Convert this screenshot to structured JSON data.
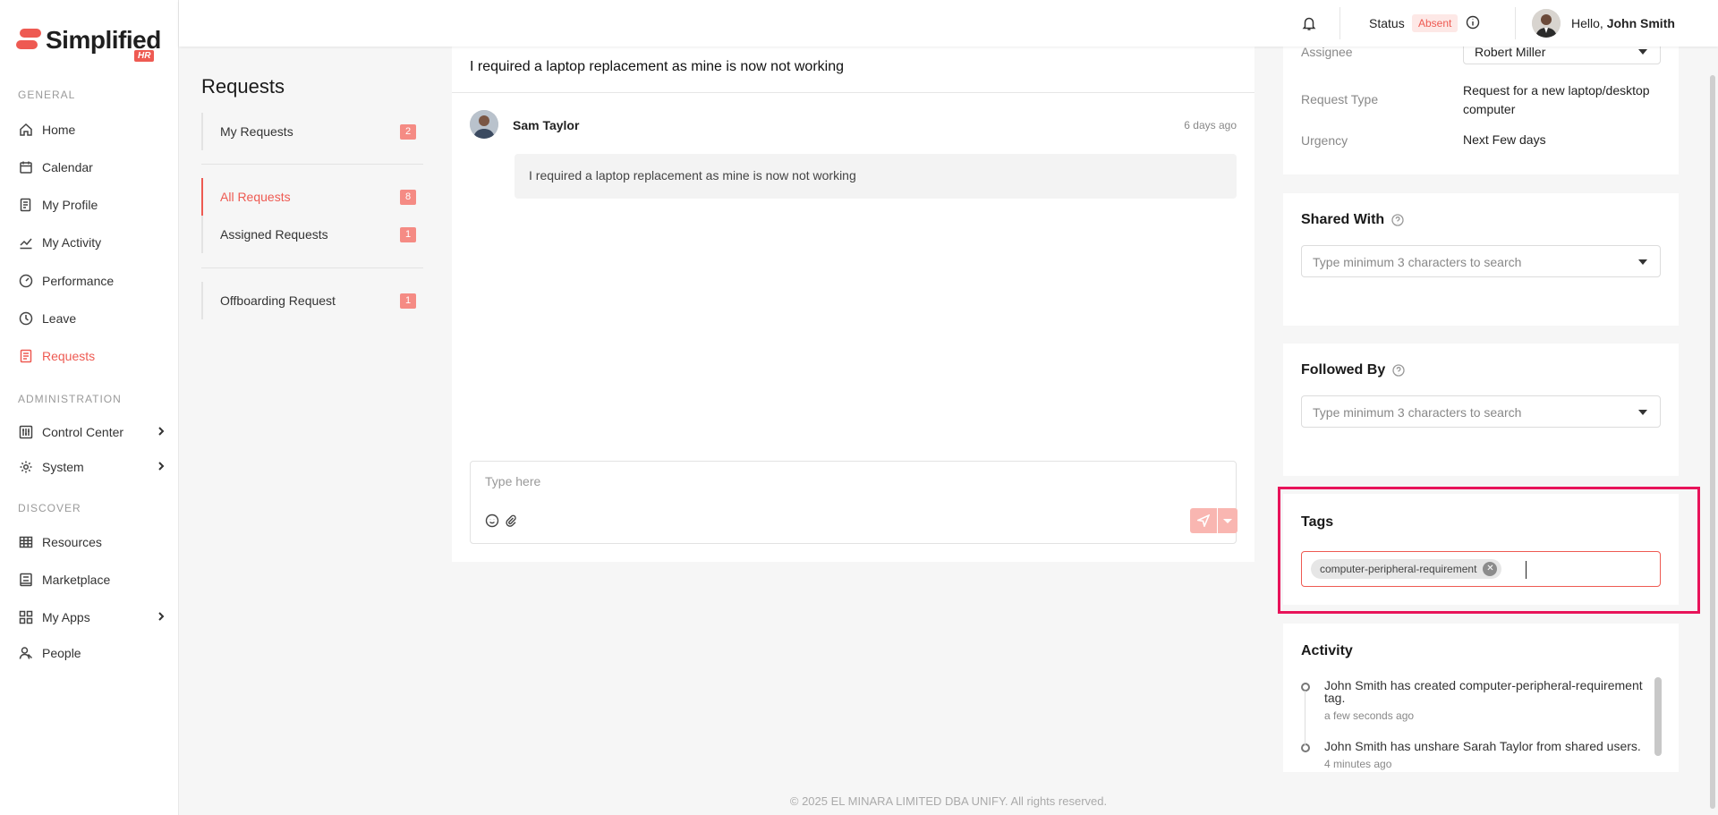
{
  "brand": {
    "name": "Simplified",
    "sub": "HR",
    "accent": "#ee5a52"
  },
  "sidebar": {
    "sections": [
      {
        "label": "GENERAL"
      },
      {
        "label": "ADMINISTRATION"
      },
      {
        "label": "DISCOVER"
      }
    ],
    "items": [
      {
        "label": "Home",
        "icon": "home-icon"
      },
      {
        "label": "Calendar",
        "icon": "calendar-icon"
      },
      {
        "label": "My Profile",
        "icon": "profile-icon"
      },
      {
        "label": "My Activity",
        "icon": "activity-icon"
      },
      {
        "label": "Performance",
        "icon": "gauge-icon"
      },
      {
        "label": "Leave",
        "icon": "clock-icon"
      },
      {
        "label": "Requests",
        "icon": "requests-icon",
        "active": true
      },
      {
        "label": "Control Center",
        "icon": "control-center-icon"
      },
      {
        "label": "System",
        "icon": "gear-icon"
      },
      {
        "label": "Resources",
        "icon": "grid-icon"
      },
      {
        "label": "Marketplace",
        "icon": "marketplace-icon"
      },
      {
        "label": "My Apps",
        "icon": "apps-icon"
      },
      {
        "label": "People",
        "icon": "people-icon"
      }
    ]
  },
  "header": {
    "status_label": "Status",
    "status_value": "Absent",
    "greeting": "Hello,",
    "user_name": "John Smith"
  },
  "requests_nav": {
    "title": "Requests",
    "groups": [
      [
        {
          "label": "My Requests",
          "count": "2"
        }
      ],
      [
        {
          "label": "All Requests",
          "count": "8",
          "active": true
        },
        {
          "label": "Assigned Requests",
          "count": "1"
        }
      ],
      [
        {
          "label": "Offboarding Request",
          "count": "1"
        }
      ]
    ]
  },
  "conversation": {
    "title": "I required a laptop replacement as mine is now not working",
    "message": {
      "author": "Sam Taylor",
      "time": "6 days ago",
      "text": "I required a laptop replacement as mine is now not working"
    },
    "compose_placeholder": "Type here"
  },
  "details": {
    "assignee_label": "Assignee",
    "assignee_value": "Robert Miller",
    "request_type_label": "Request Type",
    "request_type_value": "Request for a new laptop/desktop computer",
    "urgency_label": "Urgency",
    "urgency_value": "Next Few days"
  },
  "shared_with": {
    "title": "Shared With",
    "placeholder": "Type minimum 3 characters to search"
  },
  "followed_by": {
    "title": "Followed By",
    "placeholder": "Type minimum 3 characters to search"
  },
  "tags": {
    "title": "Tags",
    "items": [
      "computer-peripheral-requirement"
    ]
  },
  "activity": {
    "title": "Activity",
    "items": [
      {
        "text": "John Smith has created computer-peripheral-requirement tag.",
        "time": "a few seconds ago"
      },
      {
        "text": "John Smith has unshare Sarah Taylor from shared users.",
        "time": "4 minutes ago"
      }
    ]
  },
  "footer": "© 2025 EL MINARA LIMITED DBA UNIFY. All rights reserved."
}
